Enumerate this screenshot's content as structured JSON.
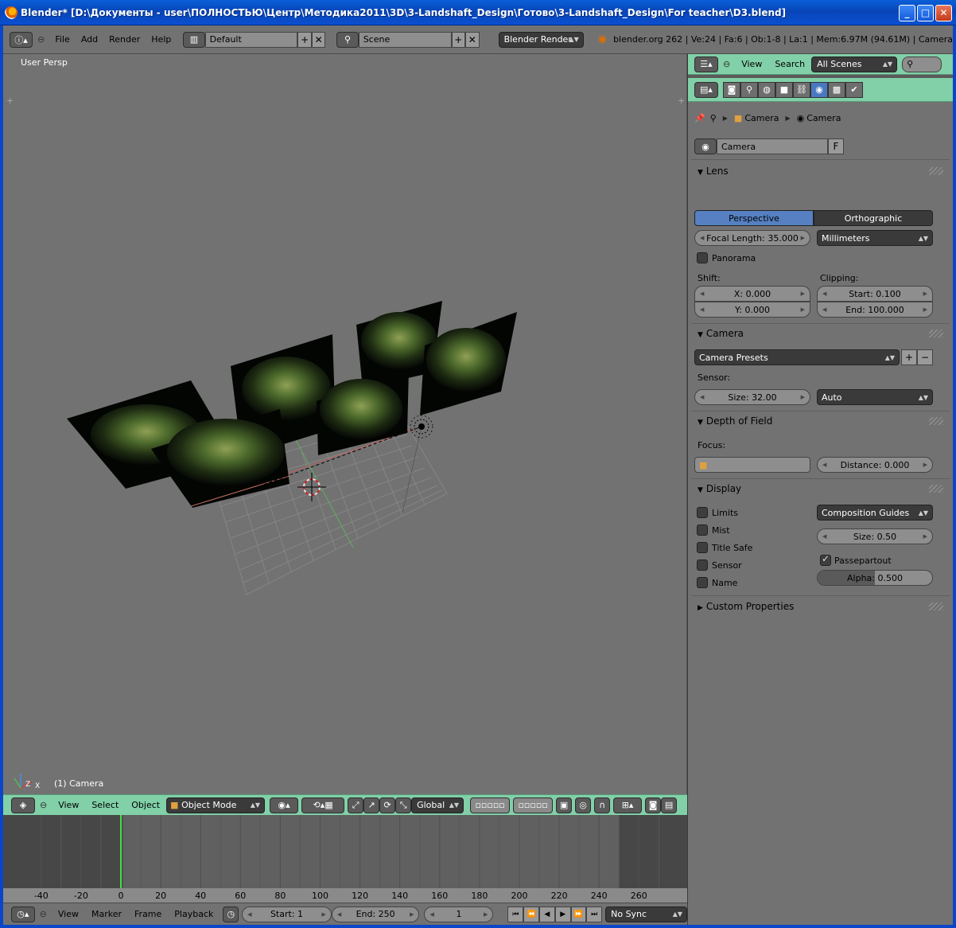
{
  "window": {
    "title": "Blender* [D:\\Документы - user\\ПОЛНОСТЬЮ\\Центр\\Методика2011\\3D\\3-Landshaft_Design\\Готово\\3-Landshaft_Design\\For teacher\\D3.blend]",
    "minimize": "_",
    "maximize": "□",
    "close": "✕"
  },
  "info_header": {
    "menus": [
      "File",
      "Add",
      "Render",
      "Help"
    ],
    "screen_layout": "Default",
    "scene": "Scene",
    "render_engine": "Blender Render",
    "stats": "blender.org 262 | Ve:24 | Fa:6 | Ob:1-8 | La:1 | Mem:6.97M (94.61M) | Camera"
  },
  "viewport": {
    "perspective_label": "User Persp",
    "object_label": "(1) Camera",
    "axis_labels": {
      "x": "X",
      "y": "Y",
      "z": "Z"
    }
  },
  "view3d_header": {
    "menus": [
      "View",
      "Select",
      "Object"
    ],
    "mode": "Object Mode",
    "orientation": "Global"
  },
  "timeline": {
    "ruler_labels": [
      "-40",
      "-20",
      "0",
      "20",
      "40",
      "60",
      "80",
      "100",
      "120",
      "140",
      "160",
      "180",
      "200",
      "220",
      "240",
      "260"
    ],
    "current_frame_marker": 0,
    "scene_range": [
      1,
      250
    ]
  },
  "timeline_header": {
    "menus": [
      "View",
      "Marker",
      "Frame",
      "Playback"
    ],
    "start": "Start: 1",
    "end": "End: 250",
    "current": "1",
    "sync": "No Sync"
  },
  "outliner_header": {
    "menus": [
      "View",
      "Search"
    ],
    "display_mode": "All Scenes"
  },
  "properties": {
    "breadcrumb": [
      "Camera",
      "Camera"
    ],
    "datablock_name": "Camera",
    "fake_user": "F",
    "lens": {
      "title": "Lens",
      "perspective": "Perspective",
      "orthographic": "Orthographic",
      "focal_length": "Focal Length: 35.000",
      "units": "Millimeters",
      "panorama": "Panorama",
      "shift_label": "Shift:",
      "shift_x": "X: 0.000",
      "shift_y": "Y: 0.000",
      "clipping_label": "Clipping:",
      "clip_start": "Start: 0.100",
      "clip_end": "End: 100.000"
    },
    "camera": {
      "title": "Camera",
      "presets": "Camera Presets",
      "sensor_label": "Sensor:",
      "size": "Size: 32.00",
      "fit": "Auto"
    },
    "dof": {
      "title": "Depth of Field",
      "focus_label": "Focus:",
      "distance": "Distance: 0.000"
    },
    "display": {
      "title": "Display",
      "limits": "Limits",
      "mist": "Mist",
      "title_safe": "Title Safe",
      "sensor": "Sensor",
      "name": "Name",
      "guides": "Composition Guides",
      "size": "Size: 0.50",
      "passepartout": "Passepartout",
      "alpha": "Alpha: 0.500",
      "alpha_value": 0.5
    },
    "custom_properties": "Custom Properties"
  },
  "colors": {
    "header_green": "#81d0a8",
    "active_blue": "#5680c2",
    "viewport_gray": "#727272"
  }
}
